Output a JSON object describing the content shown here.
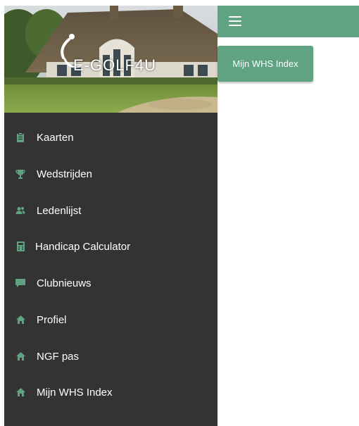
{
  "logo": {
    "text": "E-GOLF4U"
  },
  "colors": {
    "accent": "#5fa383",
    "sidebar": "#333333",
    "icon": "#5fa383"
  },
  "topbar": {
    "menu_icon": "hamburger-icon"
  },
  "main": {
    "whs_button_label": "Mijn WHS Index"
  },
  "sidebar": {
    "items": [
      {
        "label": "Kaarten",
        "icon": "clipboard-icon"
      },
      {
        "label": "Wedstrijden",
        "icon": "trophy-icon"
      },
      {
        "label": "Ledenlijst",
        "icon": "users-icon"
      },
      {
        "label": "Handicap Calculator",
        "icon": "calculator-icon"
      },
      {
        "label": "Clubnieuws",
        "icon": "chat-bubble-icon"
      },
      {
        "label": "Profiel",
        "icon": "home-icon"
      },
      {
        "label": "NGF pas",
        "icon": "home-icon"
      },
      {
        "label": "Mijn WHS Index",
        "icon": "home-icon"
      }
    ]
  }
}
